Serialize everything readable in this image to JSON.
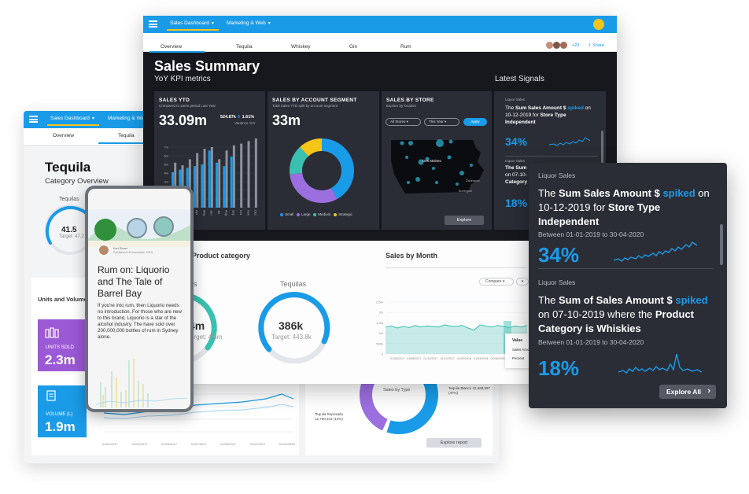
{
  "back_dashboard": {
    "menu": [
      "Sales Dashboard",
      "Marketing & Web"
    ],
    "subtabs": [
      "Overview",
      "Tequila"
    ],
    "title": "Tequila",
    "subtitle": "Category Overview",
    "gauge_label": "Tequilas",
    "gauge_value": "41.5",
    "gauge_target": "Target: 47.2",
    "section_title": "Units and Volume",
    "kpis": [
      {
        "label": "UNITS SOLD",
        "value": "2.3m",
        "color": "#9b59d6"
      },
      {
        "label": "VOLUME (L)",
        "value": "1.9m",
        "color": "#1a9be8"
      }
    ],
    "sales_by_type": {
      "title": "Sales by Type",
      "labels": [
        "Tequila Blanco 42,468,597 (47%)",
        "Tequila Reposado 12,790,341 (14%)"
      ],
      "explore": "Explore report"
    },
    "line_x_labels": [
      "01/01/2017",
      "01/03/2017",
      "01/05/2017",
      "01/07/2017",
      "01/09/2017",
      "01/11/2017",
      "01/01/2018"
    ]
  },
  "main_dashboard": {
    "menu": [
      "Sales Dashboard",
      "Marketing & Web"
    ],
    "tabs": [
      "Overview",
      "Tequila",
      "Whiskey",
      "Gin",
      "Rum"
    ],
    "avatar_more": "+23",
    "share": "Share",
    "title": "Sales Summary",
    "subtitle": "YoY KPI metrics",
    "latest_signals": "Latest Signals",
    "tile_ytd": {
      "title": "SALES YTD",
      "sub": "Compared to same period Last Year",
      "value": "33.09m",
      "compare": "524.87k",
      "change": "1.61%",
      "variance": "Variance YoY",
      "months": [
        "Jan",
        "Feb",
        "Mar",
        "Apr",
        "May",
        "Jun",
        "Jul",
        "Aug",
        "Sep",
        "Oct",
        "Nov",
        "Dec"
      ],
      "bars_current": [
        4.1,
        4.4,
        4.6,
        4.8,
        5.0,
        6.6,
        5.2,
        4.8,
        5.9,
        0,
        0,
        0
      ],
      "bars_previous": [
        5.2,
        4.9,
        5.6,
        6.3,
        6.8,
        7.0,
        5.6,
        6.6,
        7.2,
        7.4,
        7.7,
        8.0
      ],
      "ylim": [
        0,
        8
      ],
      "yticks": [
        "0",
        "1m",
        "2m",
        "3m",
        "4m",
        "5m",
        "6m",
        "7m"
      ]
    },
    "tile_segment": {
      "title": "SALES BY ACCOUNT SEGMENT",
      "sub": "Total Sales YTD split by account segment",
      "value": "33m",
      "legend": [
        "Small",
        "Large",
        "Medium",
        "Strategic"
      ],
      "shares": [
        0.42,
        0.31,
        0.15,
        0.12
      ],
      "colors": [
        "#1a9be8",
        "#9b6fe0",
        "#3ac0b0",
        "#f5c518"
      ]
    },
    "tile_store": {
      "title": "SALES BY STORE",
      "sub": "Explore by location",
      "filters": [
        "All Stores",
        "This Year"
      ],
      "apply": "Apply",
      "city_labels": [
        "Des Moines",
        "Davenport",
        "Burlington"
      ],
      "explore": "Explore"
    },
    "mini_signals": [
      {
        "kicker": "Liquor Sales",
        "text_a": "The ",
        "b1": "Sum Sales Amount $",
        "hl": " spiked",
        "text_b": " on 10-12-2019 for ",
        "b2": "Store Type Independent",
        "pct": "34%"
      },
      {
        "kicker": "Liquor Sales",
        "b1": "The Sum",
        "text_b": "on 07-10-",
        "b2": "Category",
        "pct": "18%"
      }
    ],
    "lower": {
      "product_title": "Product category",
      "gauge_left_label": "Gins",
      "gauge_left_value": "4m",
      "gauge_left_target": "Target: 4.5m",
      "gauge_right_label": "Tequilas",
      "gauge_right_value": "386k",
      "gauge_right_target": "Target: 443.8k",
      "month_title": "Sales by Month",
      "compare": "Compare",
      "y_ticks": [
        "2.5m",
        "2m",
        "1.5m",
        "1m",
        "500k",
        "0"
      ],
      "x_labels": [
        "01/06/2017",
        "01/08/2017",
        "01/10/2017",
        "01/12/2017",
        "01/02/2018",
        "01/04/2018",
        "01/06/2018",
        "01/08/2018"
      ],
      "tooltip": [
        "Value",
        "Sales Amount",
        "Percent"
      ]
    }
  },
  "phone": {
    "author": "Karl Stuart",
    "published": "Published 18 November 2019",
    "headline": "Rum on: Liquorio and The Tale of Barrel Bay",
    "body": "If you're into rum, then Liquorio needs no introduction. For those who are new to this brand, Liquorio is a star of the alcohol industry. The have sold over 200,000,000 bottles of rum in Sydney alone."
  },
  "signals_card": {
    "items": [
      {
        "kicker": "Liquor Sales",
        "t1": "The ",
        "b1": "Sum Sales Amount $",
        "hl": " spiked",
        "t2": " on 10-12-2019 for ",
        "b2": "Store Type Independent",
        "t3": "",
        "range": "Between  01-01-2019 to 30-04-2020",
        "pct": "34%"
      },
      {
        "kicker": "Liquor Sales",
        "t1": "The ",
        "b1": "Sum of Sales Amount $",
        "hl": " spiked",
        "t2": " on 07-10-2019 where the ",
        "b2": "Product Category is Whiskies",
        "t3": "",
        "range": "Between  01-01-2019 to 30-04-2020",
        "pct": "18%"
      }
    ],
    "explore_all": "Explore All"
  },
  "colors": {
    "accent": "#1a9be8",
    "purple": "#9b6fe0",
    "teal": "#3ac0b0",
    "yellow": "#f5c518",
    "dark": "#17181e",
    "tile": "#2b2d36"
  }
}
